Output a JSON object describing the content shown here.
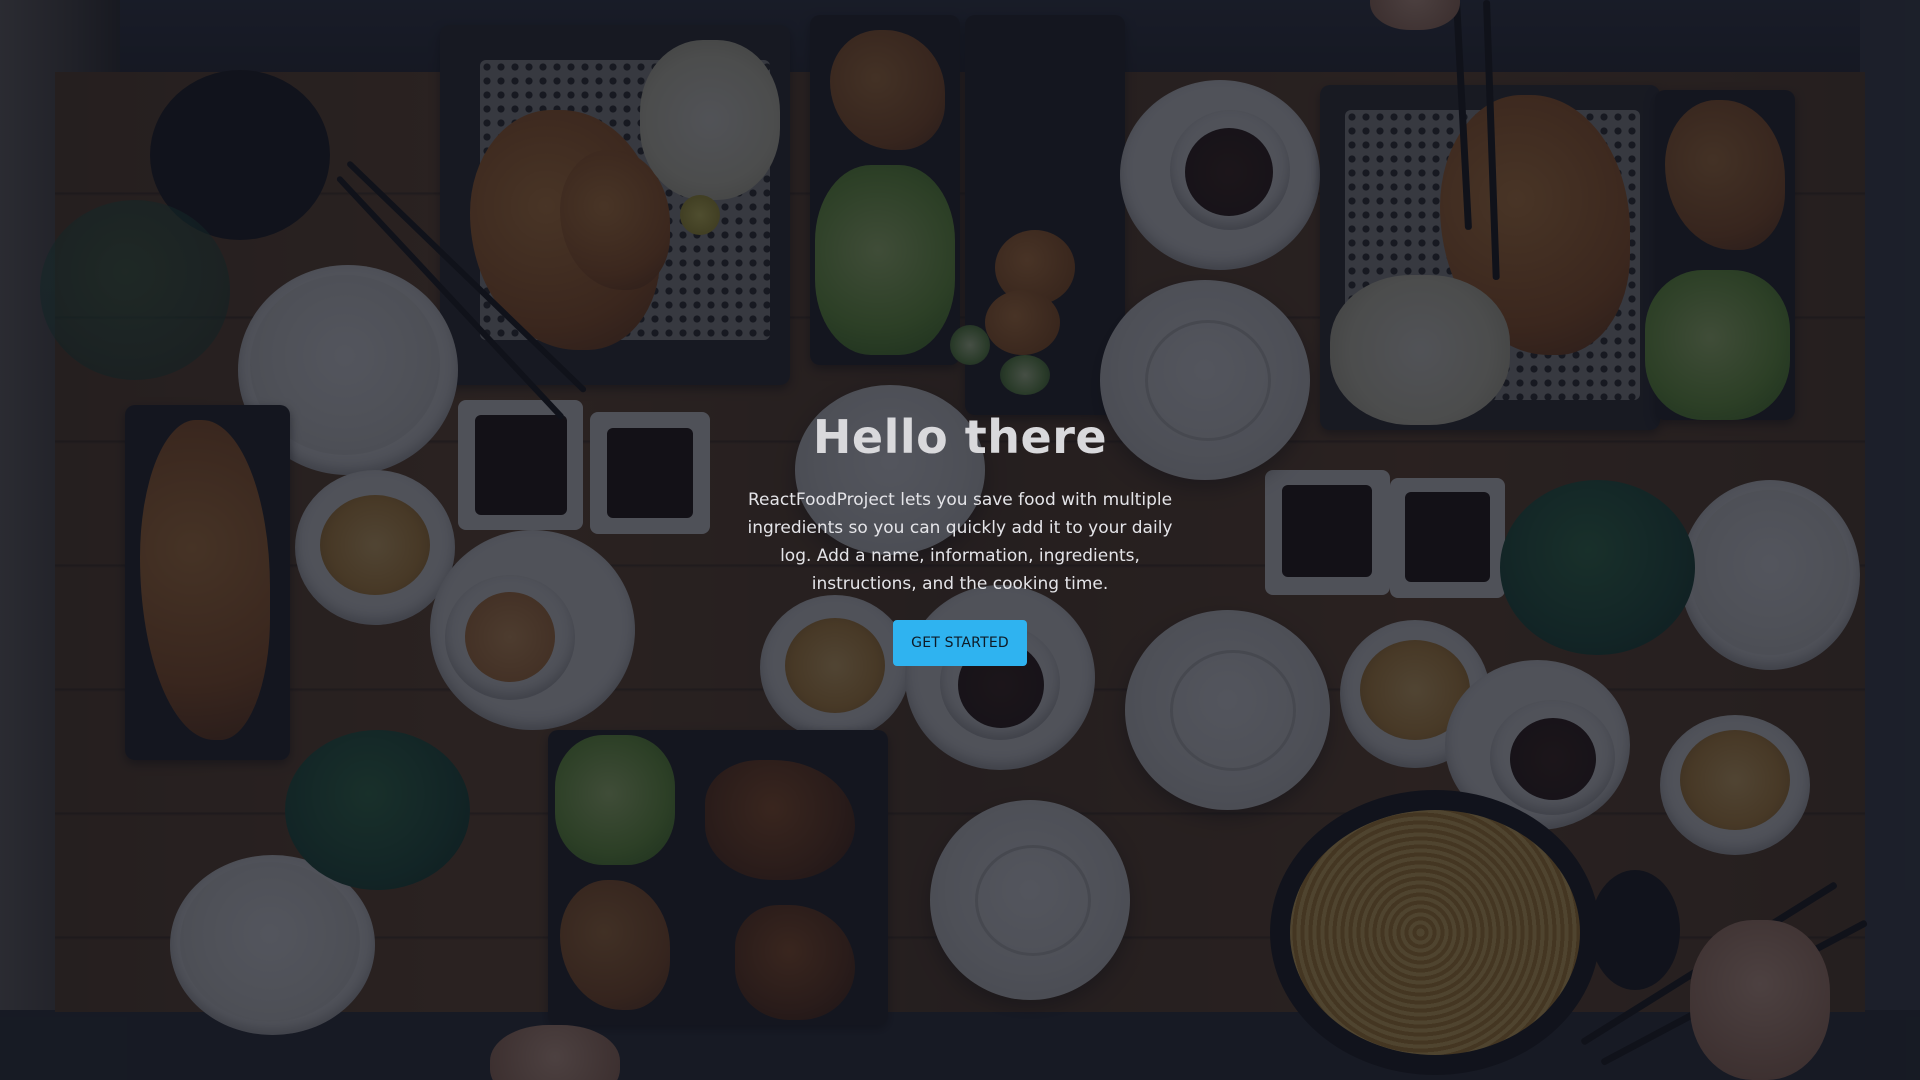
{
  "hero": {
    "title": "Hello there",
    "description": "ReactFoodProject lets you save food with multiple ingredients so you can quickly add it to your daily log. Add a name, information, ingredients, instructions, and the cooking time.",
    "button_label": "GET STARTED"
  },
  "colors": {
    "button_bg": "#2fb3f0",
    "overlay": "rgba(16, 20, 30, 0.72)",
    "title_text": "#d9d9dc"
  },
  "background": {
    "image": "overhead photo of a restaurant table with food dishes"
  }
}
